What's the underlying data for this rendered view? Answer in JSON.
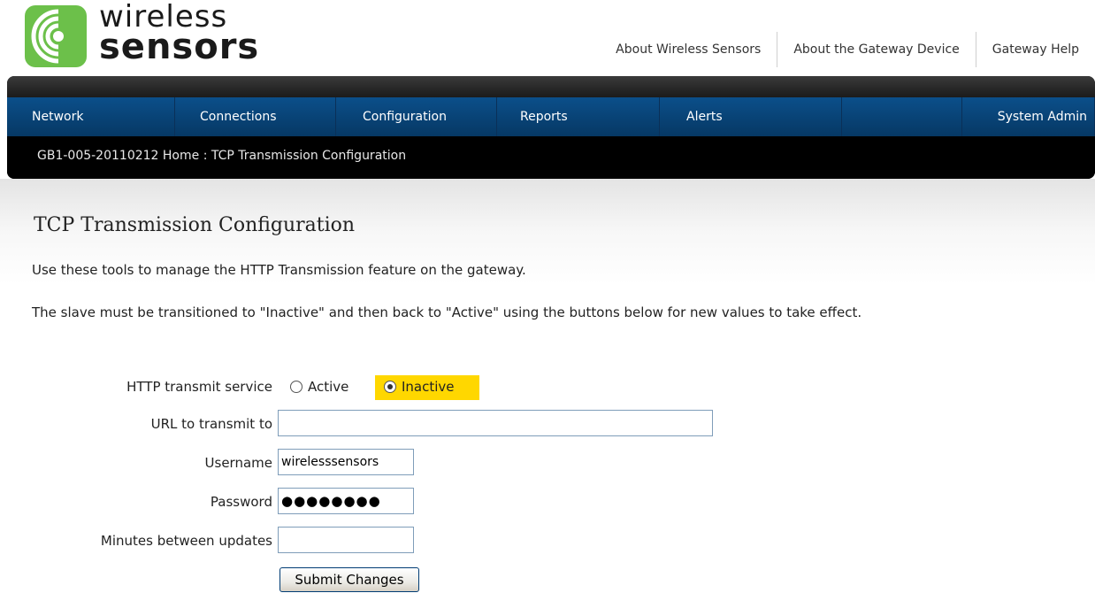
{
  "brand": {
    "line1": "wireless",
    "line2": "sensors"
  },
  "top_links": [
    "About Wireless Sensors",
    "About the Gateway Device",
    "Gateway Help"
  ],
  "nav": {
    "items": [
      "Network",
      "Connections",
      "Configuration",
      "Reports",
      "Alerts"
    ],
    "right_item": "System Admin"
  },
  "breadcrumb": "GB1-005-20110212 Home : TCP Transmission Configuration",
  "page": {
    "title": "TCP Transmission Configuration",
    "intro": "Use these tools to manage the HTTP Transmission feature on the gateway.",
    "note": "The slave must be transitioned to \"Inactive\" and then back to \"Active\" using the buttons below for new values to take effect."
  },
  "form": {
    "service_label": "HTTP transmit service",
    "option_active": "Active",
    "option_inactive": "Inactive",
    "selected": "Inactive",
    "url_label": "URL to transmit to",
    "url_value": "",
    "username_label": "Username",
    "username_value": "wirelesssensors",
    "password_label": "Password",
    "password_mask": "●●●●●●●●",
    "minutes_label": "Minutes between updates",
    "minutes_value": "",
    "submit_label": "Submit Changes"
  },
  "colors": {
    "logo_green": "#6cc04a",
    "nav_blue": "#0b4f8a",
    "highlight": "#ffd700"
  }
}
